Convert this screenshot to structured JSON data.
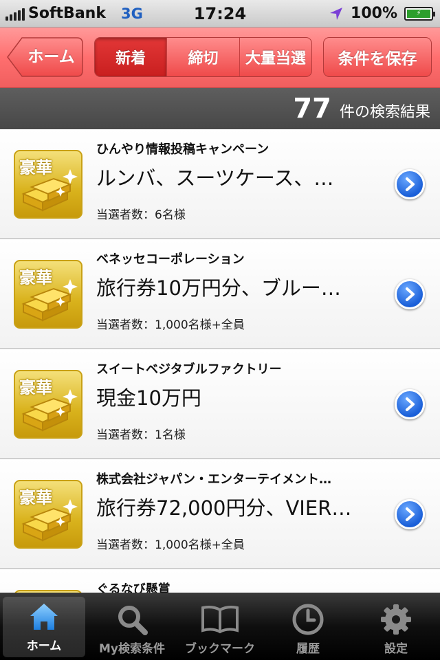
{
  "status_bar": {
    "carrier": "SoftBank",
    "network": "3G",
    "time": "17:24",
    "battery": "100%"
  },
  "nav": {
    "back_label": "ホーム",
    "segments": [
      "新着",
      "締切",
      "大量当選"
    ],
    "selected_segment": "新着",
    "save_label": "条件を保存"
  },
  "results": {
    "count": "77",
    "label": "件の検索結果"
  },
  "badge_label": "豪華",
  "items": [
    {
      "sponsor": "ひんやり情報投稿キャンペーン",
      "prize": "ルンバ、スーツケース、…",
      "winners": "当選者数：6名様"
    },
    {
      "sponsor": "ベネッセコーポレーション",
      "prize": "旅行券10万円分、ブルー…",
      "winners": "当選者数：1,000名様+全員"
    },
    {
      "sponsor": "スイートベジタブルファクトリー",
      "prize": "現金10万円",
      "winners": "当選者数：1名様"
    },
    {
      "sponsor": "株式会社ジャパン・エンターテイメント…",
      "prize": "旅行券72,000円分、VIER…",
      "winners": "当選者数：1,000名様+全員"
    },
    {
      "sponsor": "ぐるなび懸賞",
      "prize": "",
      "winners": ""
    }
  ],
  "tabs": [
    {
      "label": "ホーム",
      "icon": "home-icon",
      "active": true
    },
    {
      "label": "My検索条件",
      "icon": "search-icon",
      "active": false
    },
    {
      "label": "ブックマーク",
      "icon": "book-icon",
      "active": false
    },
    {
      "label": "履歴",
      "icon": "clock-icon",
      "active": false
    },
    {
      "label": "設定",
      "icon": "gear-icon",
      "active": false
    }
  ]
}
